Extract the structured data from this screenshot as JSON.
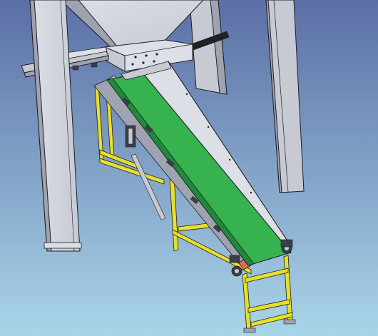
{
  "scene": {
    "subject": "inclined-belt-conveyor-under-hopper",
    "colors": {
      "background_top": "#5b6fa6",
      "background_bottom": "#a9d5e8",
      "steel_face": "#c7cad3",
      "steel_light": "#dcdfe6",
      "steel_dark": "#9fa3b0",
      "edge": "#1e1e24",
      "belt": "#36b34f",
      "belt_dark": "#21893a",
      "frame_yellow": "#e7df2c",
      "frame_yellow_dark": "#9f9a18",
      "return_belt": "#e06a5b",
      "roller_dark": "#3b3f4a",
      "shaft_black": "#202124"
    },
    "icons": [
      "hopper",
      "support-column",
      "conveyor-belt",
      "skirt-board",
      "support-frame",
      "drive-roller",
      "tail-roller",
      "idler-roller",
      "slide-gate-rail",
      "actuator-rod"
    ]
  }
}
